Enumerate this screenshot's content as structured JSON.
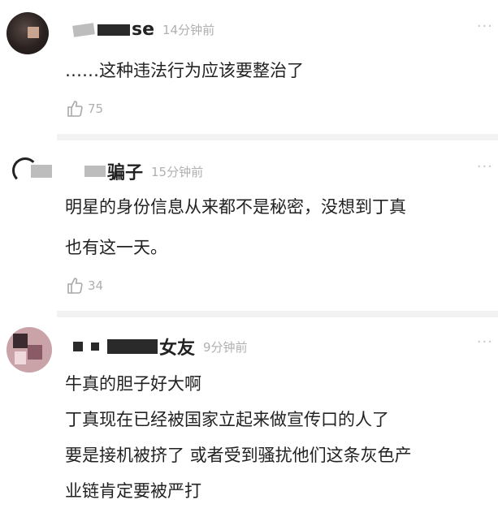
{
  "comments": [
    {
      "username_visible": "se",
      "time": "14分钟前",
      "lines": [
        "……这种违法行为应该要整治了"
      ],
      "likes": "75",
      "avatar_icon": "user-avatar-icon"
    },
    {
      "username_visible": "骗子",
      "time": "15分钟前",
      "lines": [
        "明星的身份信息从来都不是秘密，没想到丁真",
        "也有这一天。"
      ],
      "likes": "34",
      "avatar_icon": "user-avatar-icon"
    },
    {
      "username_visible": "女友",
      "time": "9分钟前",
      "lines": [
        "牛真的胆子好大啊",
        "丁真现在已经被国家立起来做宣传口的人了",
        "要是接机被挤了 或者受到骚扰他们这条灰色产",
        "业链肯定要被严打"
      ],
      "avatar_icon": "user-avatar-icon"
    }
  ],
  "more_label": "···",
  "like_icon": "thumbs-up-icon",
  "colors": {
    "meta_gray": "#b0b0b0",
    "text": "#222222",
    "divider": "#f2f2f2"
  }
}
